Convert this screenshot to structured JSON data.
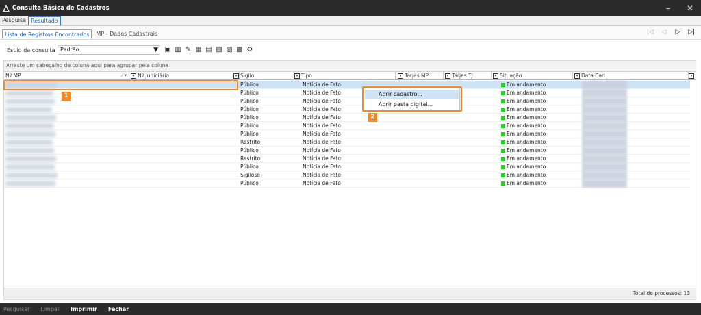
{
  "window": {
    "title": "Consulta Básica de Cadastros",
    "minimize": "–",
    "close": "✕"
  },
  "menu": {
    "items": [
      {
        "label": "Pesquisa",
        "active": false
      },
      {
        "label": "Resultado",
        "active": true
      }
    ]
  },
  "tabs": [
    {
      "label": "Lista de Registros Encontrados",
      "active": true
    },
    {
      "label": "MP - Dados Cadastrais",
      "active": false
    }
  ],
  "navigation": {
    "first": "|◁",
    "prev": "◁",
    "next": "▷",
    "last": "▷|"
  },
  "toolbar": {
    "style_label": "Estilo da consulta",
    "style_value": "Padrão",
    "tool_icons": [
      "save-icon",
      "delete-icon",
      "edit-icon",
      "columns-icon",
      "report-icon",
      "export-icon",
      "filter-icon",
      "group-icon",
      "settings-icon"
    ]
  },
  "group_area": {
    "text": "Arraste um cabeçalho de coluna aqui para agrupar pela coluna"
  },
  "columns": [
    {
      "key": "nmp",
      "label": "Nº MP"
    },
    {
      "key": "njud",
      "label": "Nº Judiciário"
    },
    {
      "key": "sigilo",
      "label": "Sigilo"
    },
    {
      "key": "tipo",
      "label": "Tipo"
    },
    {
      "key": "tarjas_mp",
      "label": "Tarjas MP"
    },
    {
      "key": "tarjas_tj",
      "label": "Tarjas TJ"
    },
    {
      "key": "situacao",
      "label": "Situação"
    },
    {
      "key": "data_cad",
      "label": "Data Cad."
    }
  ],
  "rows": [
    {
      "sigilo": "Público",
      "tipo": "Notícia de Fato",
      "situacao": "Em andamento"
    },
    {
      "sigilo": "Público",
      "tipo": "Notícia de Fato",
      "situacao": "Em andamento"
    },
    {
      "sigilo": "Público",
      "tipo": "Notícia de Fato",
      "situacao": "Em andamento"
    },
    {
      "sigilo": "Público",
      "tipo": "Notícia de Fato",
      "situacao": "Em andamento"
    },
    {
      "sigilo": "Público",
      "tipo": "Notícia de Fato",
      "situacao": "Em andamento"
    },
    {
      "sigilo": "Público",
      "tipo": "Notícia de Fato",
      "situacao": "Em andamento"
    },
    {
      "sigilo": "Público",
      "tipo": "Notícia de Fato",
      "situacao": "Em andamento"
    },
    {
      "sigilo": "Restrito",
      "tipo": "Notícia de Fato",
      "situacao": "Em andamento"
    },
    {
      "sigilo": "Público",
      "tipo": "Notícia de Fato",
      "situacao": "Em andamento"
    },
    {
      "sigilo": "Restrito",
      "tipo": "Notícia de Fato",
      "situacao": "Em andamento"
    },
    {
      "sigilo": "Público",
      "tipo": "Notícia de Fato",
      "situacao": "Em andamento"
    },
    {
      "sigilo": "Sigiloso",
      "tipo": "Notícia de Fato",
      "situacao": "Em andamento"
    },
    {
      "sigilo": "Público",
      "tipo": "Notícia de Fato",
      "situacao": "Em andamento"
    }
  ],
  "context_menu": [
    {
      "label": "Abrir cadastro...",
      "highlighted": true
    },
    {
      "label": "Abrir pasta digital...",
      "highlighted": false
    }
  ],
  "callouts": [
    "1",
    "2"
  ],
  "footer": {
    "total": "Total de processos: 13"
  },
  "bottom_actions": [
    {
      "label": "Pesquisar",
      "enabled": false
    },
    {
      "label": "Limpar",
      "enabled": false
    },
    {
      "label": "Imprimir",
      "enabled": true
    },
    {
      "label": "Fechar",
      "enabled": true
    }
  ],
  "colors": {
    "accent": "#f08a24",
    "status_green": "#1fd41f",
    "selection": "#cfe3f6",
    "titlebar": "#2b2b2b"
  }
}
